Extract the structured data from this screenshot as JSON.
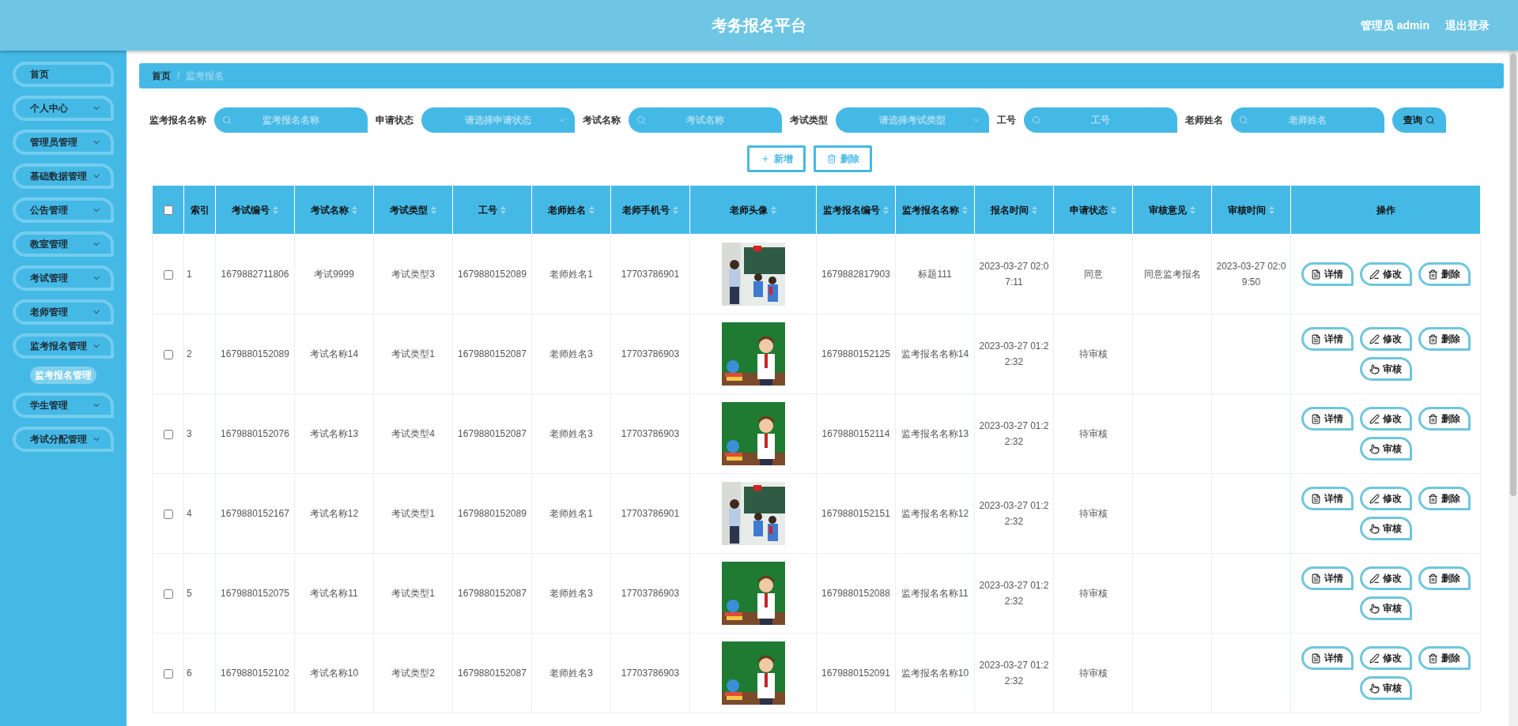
{
  "header": {
    "title": "考务报名平台",
    "user": "管理员 admin",
    "logout": "退出登录"
  },
  "sidebar": {
    "items": [
      {
        "label": "首页",
        "kind": "link"
      },
      {
        "label": "个人中心",
        "kind": "menu"
      },
      {
        "label": "管理员管理",
        "kind": "menu"
      },
      {
        "label": "基础数据管理",
        "kind": "menu"
      },
      {
        "label": "公告管理",
        "kind": "menu"
      },
      {
        "label": "教室管理",
        "kind": "menu"
      },
      {
        "label": "考试管理",
        "kind": "menu"
      },
      {
        "label": "老师管理",
        "kind": "menu"
      },
      {
        "label": "监考报名管理",
        "kind": "menu",
        "children": [
          {
            "label": "监考报名管理",
            "selected": true
          }
        ]
      },
      {
        "label": "学生管理",
        "kind": "menu"
      },
      {
        "label": "考试分配管理",
        "kind": "menu"
      }
    ]
  },
  "breadcrumb": [
    "首页",
    "监考报名"
  ],
  "breadcrumb_separator": "/",
  "filters": [
    {
      "label": "监考报名名称",
      "kind": "search",
      "placeholder": "监考报名名称"
    },
    {
      "label": "申请状态",
      "kind": "select",
      "placeholder": "请选择申请状态"
    },
    {
      "label": "考试名称",
      "kind": "search",
      "placeholder": "考试名称"
    },
    {
      "label": "考试类型",
      "kind": "select",
      "placeholder": "请选择考试类型"
    },
    {
      "label": "工号",
      "kind": "search",
      "placeholder": "工号"
    },
    {
      "label": "老师姓名",
      "kind": "search",
      "placeholder": "老师姓名"
    }
  ],
  "query_button": "查询",
  "toolbar": [
    {
      "label": "新增",
      "kind": "add"
    },
    {
      "label": "删除",
      "kind": "delete"
    }
  ],
  "table": {
    "select_all": {
      "checked": false
    },
    "columns": [
      {
        "label": "索引",
        "sortable": false
      },
      {
        "label": "考试编号",
        "sortable": true
      },
      {
        "label": "考试名称",
        "sortable": true
      },
      {
        "label": "考试类型",
        "sortable": true
      },
      {
        "label": "工号",
        "sortable": true
      },
      {
        "label": "老师姓名",
        "sortable": true
      },
      {
        "label": "老师手机号",
        "sortable": true
      },
      {
        "label": "老师头像",
        "sortable": true
      },
      {
        "label": "监考报名编号",
        "sortable": true
      },
      {
        "label": "监考报名名称",
        "sortable": true
      },
      {
        "label": "报名时间",
        "sortable": true
      },
      {
        "label": "申请状态",
        "sortable": true
      },
      {
        "label": "审核意见",
        "sortable": true
      },
      {
        "label": "审核时间",
        "sortable": true
      },
      {
        "label": "操作",
        "sortable": false
      }
    ],
    "rows": [
      {
        "checked": false,
        "cells": [
          "1",
          "1679882711806",
          "考试9999",
          "考试类型3",
          "1679880152089",
          "老师姓名1",
          "17703786901",
          {
            "kind": "picture"
          },
          "1679882817903",
          "标题111",
          "2023-03-27 02:07:11",
          "同意",
          "同意监考报名",
          "2023-03-27 02:09:50"
        ],
        "actions": [
          {
            "label": "详情",
            "kind": "detail"
          },
          {
            "label": "修改",
            "kind": "edit"
          },
          {
            "label": "删除",
            "kind": "delete"
          }
        ]
      },
      {
        "checked": false,
        "cells": [
          "2",
          "1679880152089",
          "考试名称14",
          "考试类型1",
          "1679880152087",
          "老师姓名3",
          "17703786903",
          {
            "kind": "picture"
          },
          "1679880152125",
          "监考报名名称14",
          "2023-03-27 01:22:32",
          "待审核",
          "",
          ""
        ],
        "actions": [
          {
            "label": "详情",
            "kind": "detail"
          },
          {
            "label": "修改",
            "kind": "edit"
          },
          {
            "label": "删除",
            "kind": "delete"
          },
          {
            "label": "审核",
            "kind": "review"
          }
        ]
      },
      {
        "checked": false,
        "cells": [
          "3",
          "1679880152076",
          "考试名称13",
          "考试类型4",
          "1679880152087",
          "老师姓名3",
          "17703786903",
          {
            "kind": "picture"
          },
          "1679880152114",
          "监考报名名称13",
          "2023-03-27 01:22:32",
          "待审核",
          "",
          ""
        ],
        "actions": [
          {
            "label": "详情",
            "kind": "detail"
          },
          {
            "label": "修改",
            "kind": "edit"
          },
          {
            "label": "删除",
            "kind": "delete"
          },
          {
            "label": "审核",
            "kind": "review"
          }
        ]
      },
      {
        "checked": false,
        "cells": [
          "4",
          "1679880152167",
          "考试名称12",
          "考试类型1",
          "1679880152089",
          "老师姓名1",
          "17703786901",
          {
            "kind": "picture"
          },
          "1679880152151",
          "监考报名名称12",
          "2023-03-27 01:22:32",
          "待审核",
          "",
          ""
        ],
        "actions": [
          {
            "label": "详情",
            "kind": "detail"
          },
          {
            "label": "修改",
            "kind": "edit"
          },
          {
            "label": "删除",
            "kind": "delete"
          },
          {
            "label": "审核",
            "kind": "review"
          }
        ]
      },
      {
        "checked": false,
        "cells": [
          "5",
          "1679880152075",
          "考试名称11",
          "考试类型1",
          "1679880152087",
          "老师姓名3",
          "17703786903",
          {
            "kind": "picture"
          },
          "1679880152088",
          "监考报名名称11",
          "2023-03-27 01:22:32",
          "待审核",
          "",
          ""
        ],
        "actions": [
          {
            "label": "详情",
            "kind": "detail"
          },
          {
            "label": "修改",
            "kind": "edit"
          },
          {
            "label": "删除",
            "kind": "delete"
          },
          {
            "label": "审核",
            "kind": "review"
          }
        ]
      },
      {
        "checked": false,
        "cells": [
          "6",
          "1679880152102",
          "考试名称10",
          "考试类型2",
          "1679880152087",
          "老师姓名3",
          "17703786903",
          {
            "kind": "picture"
          },
          "1679880152091",
          "监考报名名称10",
          "2023-03-27 01:22:32",
          "待审核",
          "",
          ""
        ],
        "actions": [
          {
            "label": "详情",
            "kind": "detail"
          },
          {
            "label": "修改",
            "kind": "edit"
          },
          {
            "label": "删除",
            "kind": "delete"
          },
          {
            "label": "审核",
            "kind": "review"
          }
        ]
      }
    ]
  }
}
